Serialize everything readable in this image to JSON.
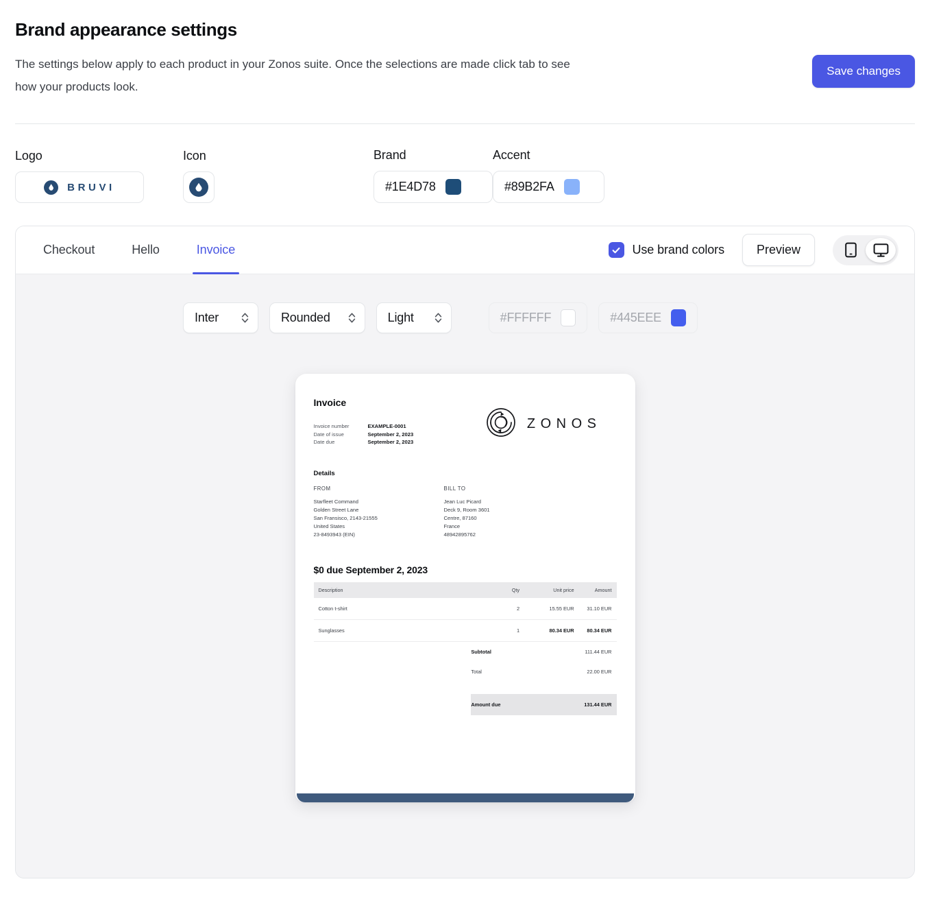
{
  "header": {
    "title": "Brand appearance settings",
    "description": "The settings below apply to each product in your Zonos suite. Once the selections are made click tab to see how your products look.",
    "save_label": "Save changes",
    "save_color": "#4A57E3"
  },
  "brand_fields": {
    "logo_label": "Logo",
    "logo_text": "BRUVI",
    "icon_label": "Icon",
    "brand_label": "Brand",
    "brand_value": "#1E4D78",
    "brand_color": "#1E4D78",
    "accent_label": "Accent",
    "accent_value": "#89B2FA",
    "accent_color": "#89B2FA",
    "mark_color": "#274B73"
  },
  "panel": {
    "tabs": [
      {
        "label": "Checkout",
        "active": false
      },
      {
        "label": "Hello",
        "active": false
      },
      {
        "label": "Invoice",
        "active": true
      }
    ],
    "use_brand_colors_label": "Use brand colors",
    "use_brand_colors_checked": true,
    "preview_label": "Preview",
    "devices": [
      {
        "name": "mobile",
        "active": false
      },
      {
        "name": "desktop",
        "active": true
      }
    ],
    "controls": {
      "font": "Inter",
      "corners": "Rounded",
      "theme": "Light",
      "background_hex": "#FFFFFF",
      "background_color": "#FFFFFF",
      "primary_hex": "#445EEE",
      "primary_color": "#445EEE"
    }
  },
  "invoice": {
    "title": "Invoice",
    "brand_name": "ZONOS",
    "meta": [
      {
        "key": "Invoice number",
        "value": "EXAMPLE-0001"
      },
      {
        "key": "Date of issue",
        "value": "September 2, 2023"
      },
      {
        "key": "Date due",
        "value": "September 2, 2023"
      }
    ],
    "details_title": "Details",
    "from_heading": "FROM",
    "from_lines": [
      "Starfleet Command",
      "Golden Street Lane",
      "San Fransisco, 2143-21555",
      "United States",
      "23-8493943 (EIN)"
    ],
    "bill_to_heading": "BILL TO",
    "bill_to_lines": [
      "Jean Luc Picard",
      "Deck 9, Room 3601",
      "Centre, 87160",
      "France",
      "48942895762"
    ],
    "due_title": "$0 due September 2, 2023",
    "table": {
      "headers": [
        "Description",
        "Qty",
        "Unit price",
        "Amount"
      ],
      "rows": [
        {
          "description": "Cotton t-shirt",
          "qty": "2",
          "unit_price": "15.55 EUR",
          "amount": "31.10 EUR"
        },
        {
          "description": "Sunglasses",
          "qty": "1",
          "unit_price": "80.34 EUR",
          "amount": "80.34 EUR"
        }
      ],
      "totals": [
        {
          "label": "Subtotal",
          "value": "111.44 EUR"
        },
        {
          "label": "Total",
          "value": "22.00 EUR"
        }
      ],
      "amount_due_label": "Amount due",
      "amount_due_value": "131.44 EUR"
    },
    "footer_bar_color": "#3F5A7D"
  }
}
